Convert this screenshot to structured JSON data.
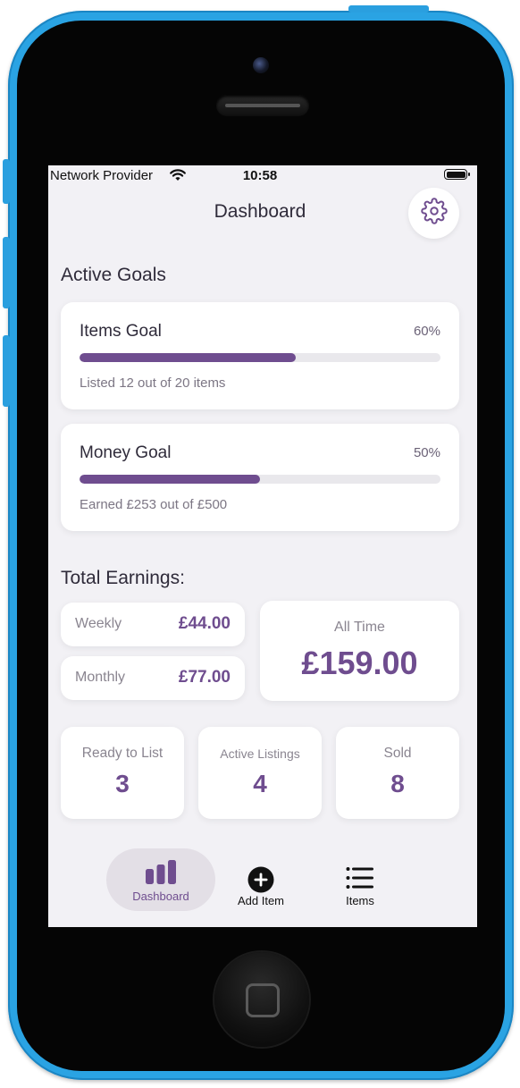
{
  "status_bar": {
    "carrier": "Network Provider",
    "time": "10:58"
  },
  "header": {
    "title": "Dashboard",
    "settings_icon": "gear-icon"
  },
  "active_goals": {
    "title": "Active Goals",
    "goals": [
      {
        "name": "Items Goal",
        "percent_label": "60%",
        "progress": 0.6,
        "description": "Listed 12 out of 20 items"
      },
      {
        "name": "Money Goal",
        "percent_label": "50%",
        "progress": 0.5,
        "description": "Earned £253 out of £500"
      }
    ]
  },
  "earnings": {
    "title": "Total Earnings:",
    "weekly": {
      "label": "Weekly",
      "value": "£44.00"
    },
    "monthly": {
      "label": "Monthly",
      "value": "£77.00"
    },
    "all_time": {
      "label": "All Time",
      "value": "£159.00"
    }
  },
  "stats": [
    {
      "label": "Ready to List",
      "value": "3"
    },
    {
      "label": "Active Listings",
      "value": "4"
    },
    {
      "label": "Sold",
      "value": "8"
    }
  ],
  "tabbar": {
    "tabs": [
      {
        "label": "Dashboard",
        "icon": "bar-chart-icon",
        "active": true
      },
      {
        "label": "Add Item",
        "icon": "add-circle-icon",
        "active": false
      },
      {
        "label": "Items",
        "icon": "list-icon",
        "active": false
      }
    ]
  },
  "colors": {
    "accent": "#6f4d8f",
    "screen_bg": "#f2f1f5",
    "shell": "#2aa3e3"
  }
}
